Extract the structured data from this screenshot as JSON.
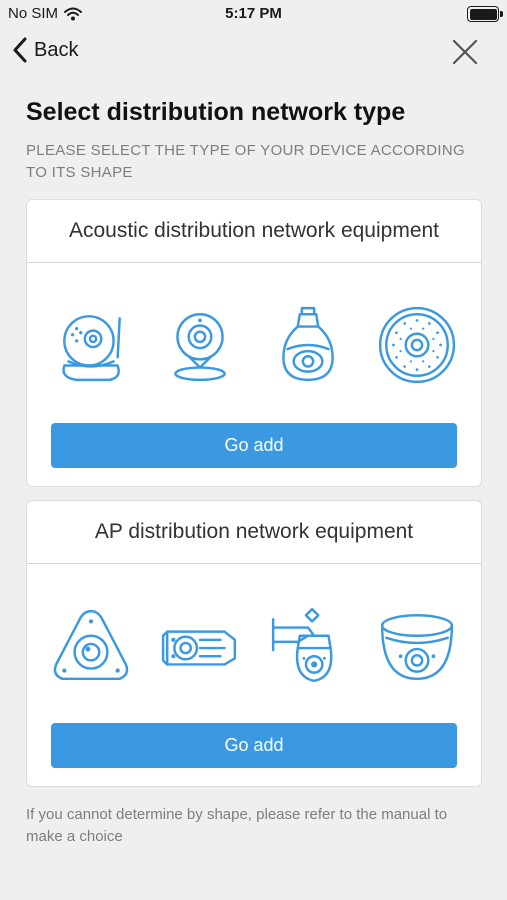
{
  "status_bar": {
    "carrier": "No SIM",
    "time": "5:17 PM"
  },
  "nav": {
    "back_label": "Back"
  },
  "page": {
    "title": "Select distribution network type",
    "subtitle": "PLEASE SELECT THE TYPE OF YOUR DEVICE ACCORDING TO ITS SHAPE"
  },
  "cards": [
    {
      "title": "Acoustic distribution network equipment",
      "devices": [
        "pan-tilt-camera-icon",
        "cube-camera-icon",
        "bulb-camera-icon",
        "round-speaker-camera-icon"
      ],
      "button_label": "Go add"
    },
    {
      "title": "AP distribution network equipment",
      "devices": [
        "fisheye-camera-icon",
        "bullet-camera-icon",
        "speed-dome-camera-icon",
        "dome-camera-icon"
      ],
      "button_label": "Go add"
    }
  ],
  "footer_note": "If you cannot determine by shape, please refer to the manual to make a choice",
  "colors": {
    "accent": "#3a99e0",
    "background": "#efefef"
  }
}
